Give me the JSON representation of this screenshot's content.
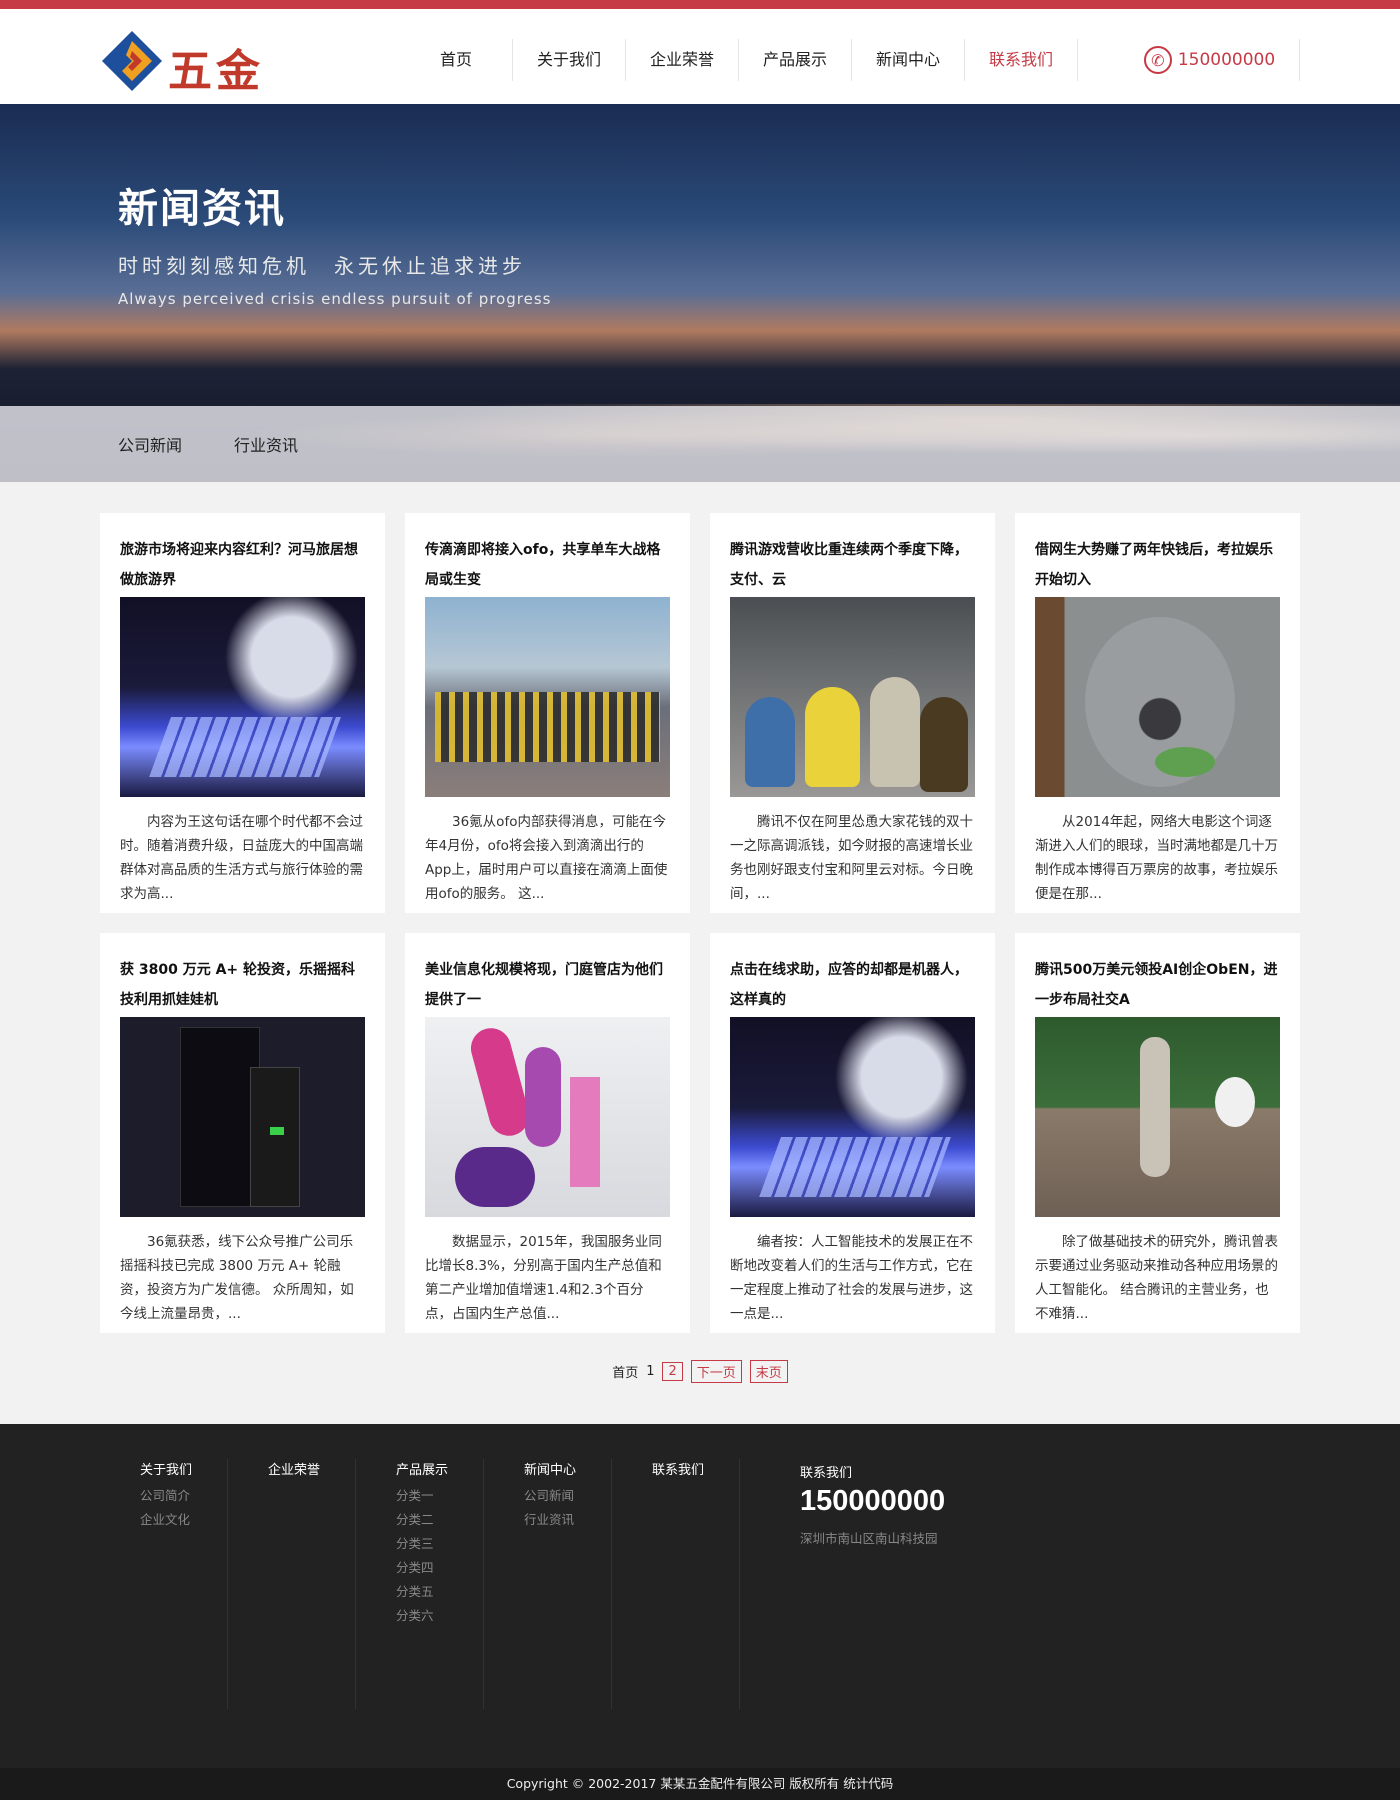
{
  "brand": {
    "name": "五金"
  },
  "nav": {
    "items": [
      {
        "label": "首页"
      },
      {
        "label": "关于我们"
      },
      {
        "label": "企业荣誉"
      },
      {
        "label": "产品展示"
      },
      {
        "label": "新闻中心"
      },
      {
        "label": "联系我们",
        "active": true
      }
    ],
    "phone": "150000000"
  },
  "banner": {
    "title": "新闻资讯",
    "subtitle": "时时刻刻感知危机　永无休止追求进步",
    "subtitle_en": "Always perceived crisis endless pursuit of progress"
  },
  "subnav": {
    "items": [
      {
        "label": "公司新闻"
      },
      {
        "label": "行业资讯"
      }
    ]
  },
  "news": [
    {
      "title": "旅游市场将迎来内容红利？河马旅居想做旅游界",
      "desc": "内容为王这句话在哪个时代都不会过时。随着消费升级，日益庞大的中国高端群体对高品质的生活方式与旅行体验的需求为高..."
    },
    {
      "title": "传滴滴即将接入ofo，共享单车大战格局或生变",
      "desc": "36氪从ofo内部获得消息，可能在今年4月份，ofo将会接入到滴滴出行的App上，届时用户可以直接在滴滴上面使用ofo的服务。 这..."
    },
    {
      "title": "腾讯游戏营收比重连续两个季度下降，支付、云",
      "desc": "腾讯不仅在阿里怂恿大家花钱的双十一之际高调派钱，如今财报的高速增长业务也刚好跟支付宝和阿里云对标。今日晚间，..."
    },
    {
      "title": "借网生大势赚了两年快钱后，考拉娱乐开始切入",
      "desc": "从2014年起，网络大电影这个词逐渐进入人们的眼球，当时满地都是几十万制作成本博得百万票房的故事，考拉娱乐便是在那..."
    },
    {
      "title": "获 3800 万元 A+ 轮投资，乐摇摇科技利用抓娃娃机",
      "desc": "36氪获悉，线下公众号推广公司乐摇摇科技已完成 3800 万元 A+ 轮融资，投资方为广发信德。 众所周知，如今线上流量昂贵，..."
    },
    {
      "title": "美业信息化规模将现，门庭管店为他们提供了一",
      "desc": "数据显示，2015年，我国服务业同比增长8.3%，分别高于国内生产总值和第二产业增加值增速1.4和2.3个百分点，占国内生产总值..."
    },
    {
      "title": "点击在线求助，应答的却都是机器人，这样真的",
      "desc": "编者按：人工智能技术的发展正在不断地改变着人们的生活与工作方式，它在一定程度上推动了社会的发展与进步，这一点是..."
    },
    {
      "title": "腾讯500万美元领投AI创企ObEN，进一步布局社交A",
      "desc": "除了做基础技术的研究外，腾讯曾表示要通过业务驱动来推动各种应用场景的人工智能化。 结合腾讯的主营业务，也不难猜..."
    }
  ],
  "pagination": {
    "first": "首页",
    "current": "1",
    "page2": "2",
    "next": "下一页",
    "last": "末页"
  },
  "footer": {
    "cols": [
      {
        "head": "关于我们",
        "links": [
          "公司简介",
          "企业文化"
        ]
      },
      {
        "head": "企业荣誉",
        "links": []
      },
      {
        "head": "产品展示",
        "links": [
          "分类一",
          "分类二",
          "分类三",
          "分类四",
          "分类五",
          "分类六"
        ]
      },
      {
        "head": "新闻中心",
        "links": [
          "公司新闻",
          "行业资讯"
        ]
      },
      {
        "head": "联系我们",
        "links": []
      }
    ],
    "contact_head": "联系我们",
    "contact_phone": "150000000",
    "address": "深圳市南山区南山科技园",
    "copyright": "Copyright © 2002-2017 某某五金配件有限公司 版权所有 统计代码"
  }
}
